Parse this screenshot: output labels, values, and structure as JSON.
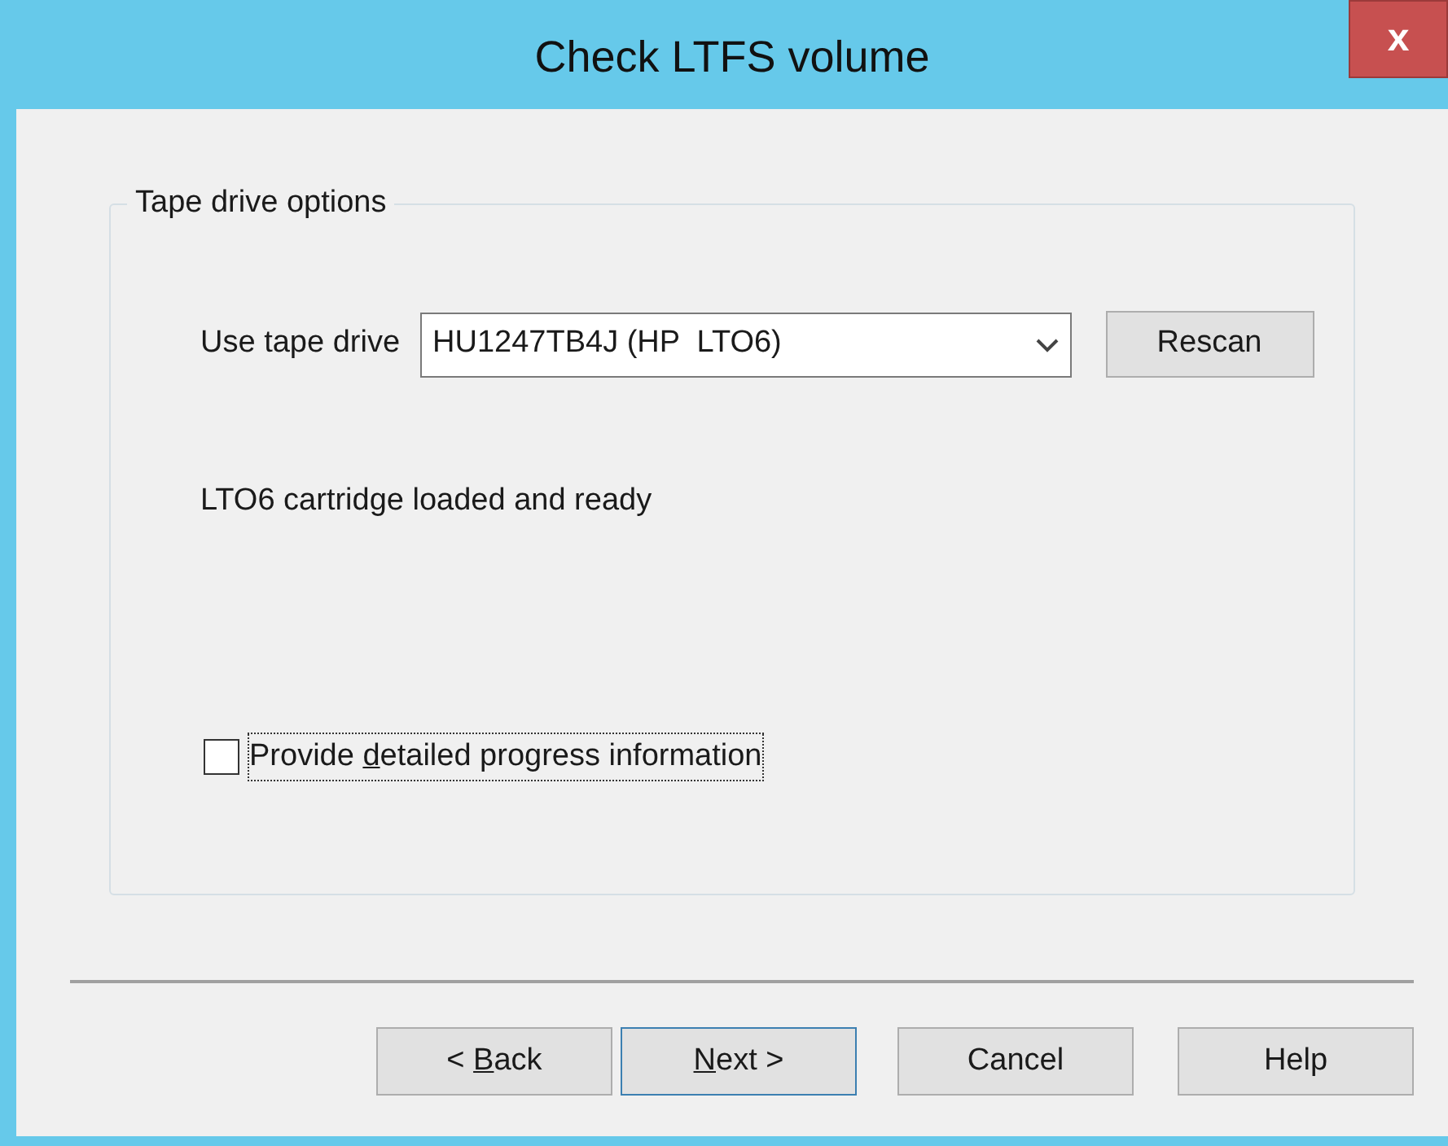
{
  "window": {
    "title": "Check LTFS volume",
    "close": "x"
  },
  "group": {
    "title": "Tape drive options",
    "drive": {
      "label": "Use tape drive",
      "value": "HU1247TB4J (HP  LTO6)",
      "button": "Rescan"
    },
    "status": "LTO6 cartridge loaded and ready",
    "checkbox": {
      "before": "Provide ",
      "key": "d",
      "after": "etailed progress information",
      "checked": false,
      "focused": true
    }
  },
  "buttons": [
    {
      "before": "< ",
      "key": "B",
      "after": "ack",
      "default": false
    },
    {
      "key": "N",
      "after": "ext >",
      "default": true
    },
    {
      "after": "Cancel",
      "default": false
    },
    {
      "after": "Help",
      "default": false
    }
  ]
}
